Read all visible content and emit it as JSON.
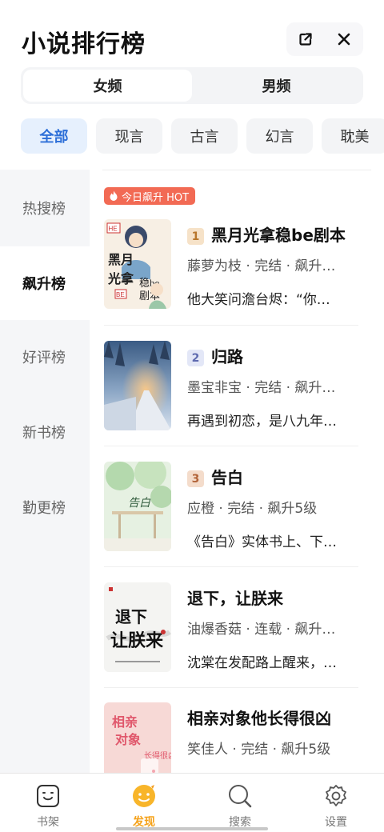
{
  "header": {
    "title": "小说排行榜"
  },
  "gender_tabs": [
    {
      "label": "女频",
      "active": true
    },
    {
      "label": "男频",
      "active": false
    }
  ],
  "categories": [
    "全部",
    "现言",
    "古言",
    "幻言",
    "耽美"
  ],
  "sidebar": [
    "热搜榜",
    "飙升榜",
    "好评榜",
    "新书榜",
    "勤更榜"
  ],
  "hot_badge": "今日飙升 HOT",
  "books": [
    {
      "rank": "1",
      "title": "黑月光拿稳be剧本",
      "meta": "藤萝为枝 · 完结 · 飙升…",
      "desc": "他大笑问澹台烬：“你…",
      "cover_text": "黑月光拿稳be剧本",
      "rank_color": "#f6e2c8",
      "rank_text_color": "#b8762b"
    },
    {
      "rank": "2",
      "title": "归路",
      "meta": "墨宝非宝 · 完结 · 飙升…",
      "desc": "再遇到初恋，是八九年…",
      "cover_text": "",
      "rank_color": "#e3e7f7",
      "rank_text_color": "#5f6bb0"
    },
    {
      "rank": "3",
      "title": "告白",
      "meta": "应橙 · 完结 · 飙升5级",
      "desc": "《告白》实体书上、下…",
      "cover_text": "告白",
      "rank_color": "#f4dccb",
      "rank_text_color": "#b2643a"
    },
    {
      "rank": "",
      "title": "退下，让朕来",
      "meta": "油爆香菇 · 连载 · 飙升…",
      "desc": "沈棠在发配路上醒来，…",
      "cover_text": "退下让朕来",
      "rank_color": "",
      "rank_text_color": ""
    },
    {
      "rank": "",
      "title": "相亲对象他长得很凶",
      "meta": "笑佳人 · 完结 · 飙升5级",
      "desc": "",
      "cover_text": "相亲对象他长得很凶",
      "rank_color": "",
      "rank_text_color": ""
    }
  ],
  "tabbar": [
    {
      "label": "书架",
      "icon": "bookshelf-icon",
      "active": false
    },
    {
      "label": "发现",
      "icon": "discover-icon",
      "active": true
    },
    {
      "label": "搜索",
      "icon": "search-icon",
      "active": false
    },
    {
      "label": "设置",
      "icon": "settings-icon",
      "active": false
    }
  ],
  "colors": {
    "accent": "#2d6fd8",
    "hot": "#f26a54",
    "tab_active": "#f5a21a"
  }
}
